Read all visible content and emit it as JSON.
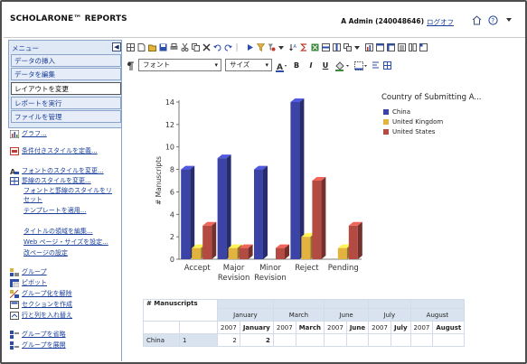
{
  "header": {
    "brand": "SCHOLARONE™ REPORTS",
    "user": "A Admin (240048646)",
    "logout": "ログオフ"
  },
  "sidebar": {
    "menu_title": "メニュー",
    "items": [
      {
        "label": "データの挿入"
      },
      {
        "label": "データを編集"
      },
      {
        "label": "レイアウトを変更"
      },
      {
        "label": "レポートを実行"
      },
      {
        "label": "ファイルを管理"
      }
    ],
    "tools": [
      {
        "label": "グラフ...",
        "icon": "chart-icon"
      },
      {
        "label": "条件付きスタイルを定義...",
        "icon": "conditional-style-icon"
      },
      {
        "label": "フォントのスタイルを変更...",
        "icon": "font-style-icon"
      },
      {
        "label": "罫線のスタイルを変更...",
        "icon": "border-style-icon"
      },
      {
        "label": "フォントと罫線のスタイルをリ",
        "icon": ""
      },
      {
        "label": "セット",
        "icon": ""
      },
      {
        "label": "テンプレートを適用...",
        "icon": ""
      },
      {
        "label": "タイトルの領域を編集...",
        "icon": ""
      },
      {
        "label": "Web ページ・サイズを設定...",
        "icon": ""
      },
      {
        "label": "改ページの設定",
        "icon": ""
      },
      {
        "label": "グループ",
        "icon": "group-icon"
      },
      {
        "label": "ピボット",
        "icon": "pivot-icon"
      },
      {
        "label": "グループ化を解除",
        "icon": "ungroup-icon"
      },
      {
        "label": "セクションを作成",
        "icon": "section-icon"
      },
      {
        "label": "行と列を入れ替え",
        "icon": "swap-icon"
      },
      {
        "label": "グループを省略",
        "icon": "collapse-group-icon"
      },
      {
        "label": "グループを展開",
        "icon": "expand-group-icon"
      }
    ]
  },
  "toolbar": {
    "font_select": "フォント",
    "size_select": "サイズ"
  },
  "chart_data": {
    "type": "bar",
    "categories": [
      "Accept",
      "Major Revision",
      "Minor Revision",
      "Reject",
      "Pending"
    ],
    "series": [
      {
        "name": "China",
        "values": [
          8,
          9,
          8,
          14,
          0
        ],
        "color": "#3b43a6"
      },
      {
        "name": "United Kingdom",
        "values": [
          1,
          1,
          0,
          2,
          1
        ],
        "color": "#e3b33f"
      },
      {
        "name": "United States",
        "values": [
          3,
          1,
          1,
          7,
          3
        ],
        "color": "#b34b43"
      }
    ],
    "ylabel": "# Manuscripts",
    "legend_title": "Country of Submitting A...",
    "ylim": [
      0,
      14
    ],
    "yticks": [
      0,
      2,
      4,
      6,
      8,
      10,
      12,
      14
    ],
    "legend_position": "top-right",
    "grid": false
  },
  "pivot": {
    "header_label": "# Manuscripts",
    "months": [
      "January",
      "March",
      "June",
      "July",
      "August"
    ],
    "subheaders": [
      "2007",
      "January",
      "2007",
      "March",
      "2007",
      "June",
      "2007",
      "July",
      "2007",
      "August"
    ],
    "row": {
      "country": "China",
      "c1": "1",
      "c2": "2",
      "c3": "2"
    }
  }
}
